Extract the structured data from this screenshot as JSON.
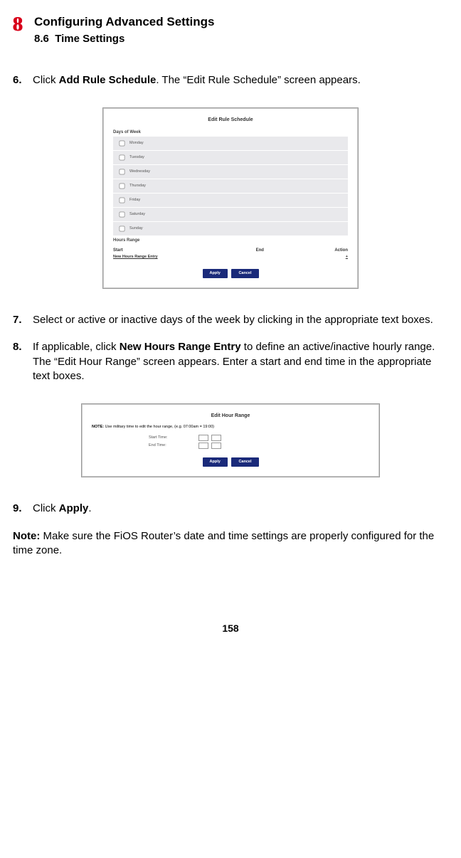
{
  "chapter": {
    "num": "8",
    "title": "Configuring Advanced Settings",
    "section_num": "8.6",
    "section_title": "Time Settings"
  },
  "steps": {
    "s6_num": "6.",
    "s6_pre": "Click ",
    "s6_bold": "Add Rule Schedule",
    "s6_post": ". The “Edit Rule Schedule” screen appears.",
    "s7_num": "7.",
    "s7_text": "Select or active or inactive days of the week by clicking in the appropriate text boxes.",
    "s8_num": "8.",
    "s8_pre": "If applicable, click ",
    "s8_bold": "New Hours Range Entry",
    "s8_post": " to define an active/inactive hourly range. The “Edit Hour Range” screen appears. Enter a start and end time in the appropriate text boxes.",
    "s9_num": "9.",
    "s9_pre": "Click ",
    "s9_bold": "Apply",
    "s9_post": "."
  },
  "note": {
    "label": "Note:",
    "text": " Make sure the FiOS Router’s date and time settings are properly configured for the time zone."
  },
  "fig1": {
    "title": "Edit Rule Schedule",
    "days_header": "Days of Week",
    "days": [
      "Monday",
      "Tuesday",
      "Wednesday",
      "Thursday",
      "Friday",
      "Saturday",
      "Sunday"
    ],
    "hours_header": "Hours Range",
    "col_start": "Start",
    "col_end": "End",
    "col_action": "Action",
    "link": "New Hours Range Entry",
    "add_icon": "+",
    "btn_apply": "Apply",
    "btn_cancel": "Cancel"
  },
  "fig2": {
    "title": "Edit Hour Range",
    "note_bold": "NOTE:",
    "note_rest": " Use military time to edit the hour range, (e.g. 07:00am = 19:00)",
    "start_label": "Start Time:",
    "end_label": "End Time:",
    "btn_apply": "Apply",
    "btn_cancel": "Cancel"
  },
  "page_number": "158"
}
